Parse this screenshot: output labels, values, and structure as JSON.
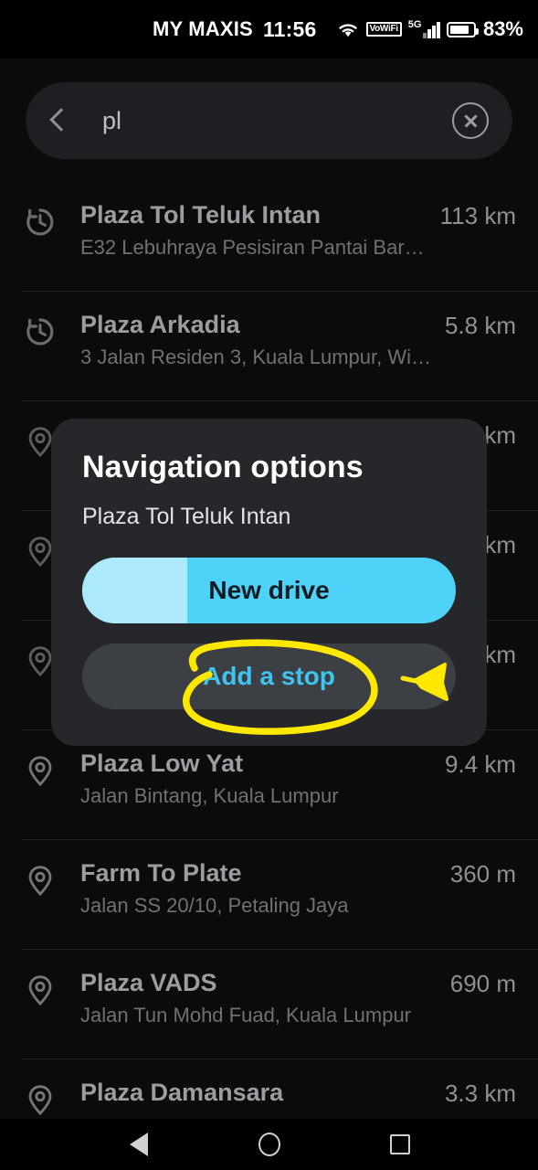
{
  "statusbar": {
    "carrier": "MY MAXIS",
    "time": "11:56",
    "wifi_icon": "wifi-icon",
    "vowifi_label": "VoWiFi",
    "network_label": "5G",
    "battery_icon": "battery-icon",
    "battery_percent": "83%"
  },
  "search": {
    "back_icon": "back-chevron-icon",
    "value": "pl",
    "clear_icon": "clear-circle-icon"
  },
  "results": [
    {
      "icon": "history-clock-icon",
      "title": "Plaza Tol Teluk Intan",
      "subtitle": "E32 Lebuhraya Pesisiran Pantai Bara…",
      "distance": "113 km"
    },
    {
      "icon": "history-clock-icon",
      "title": "Plaza Arkadia",
      "subtitle": "3 Jalan Residen 3, Kuala Lumpur, Wil…",
      "distance": "5.8 km"
    },
    {
      "icon": "map-pin-icon",
      "title": "",
      "subtitle": "",
      "distance": "km"
    },
    {
      "icon": "map-pin-icon",
      "title": "",
      "subtitle": "",
      "distance": "km"
    },
    {
      "icon": "map-pin-icon",
      "title": "",
      "subtitle": "",
      "distance": "km"
    },
    {
      "icon": "map-pin-icon",
      "title": "Plaza Low Yat",
      "subtitle": "Jalan Bintang, Kuala Lumpur",
      "distance": "9.4 km"
    },
    {
      "icon": "map-pin-icon",
      "title": "Farm To Plate",
      "subtitle": "Jalan SS 20/10, Petaling Jaya",
      "distance": "360 m"
    },
    {
      "icon": "map-pin-icon",
      "title": "Plaza VADS",
      "subtitle": "Jalan Tun Mohd Fuad, Kuala Lumpur",
      "distance": "690 m"
    },
    {
      "icon": "map-pin-icon",
      "title": "Plaza Damansara",
      "subtitle": "",
      "distance": "3.3 km"
    }
  ],
  "dialog": {
    "title": "Navigation options",
    "subtitle": "Plaza Tol Teluk Intan",
    "primary_button": "New drive",
    "secondary_button": "Add a stop"
  },
  "annotation": {
    "highlight_icon": "yellow-ellipse-highlight",
    "cursor_icon": "yellow-arrow-cursor",
    "color": "#FFE800"
  },
  "navbar": {
    "back_icon": "nav-back-triangle-icon",
    "home_icon": "nav-home-circle-icon",
    "recents_icon": "nav-recents-square-icon"
  },
  "colors": {
    "accent_cyan": "#4ED2F7",
    "accent_cyan_light": "#ABE9FB",
    "link_cyan": "#3FC4F0",
    "dialog_bg": "#26272B",
    "button_bg": "#3C4045",
    "screen_bg": "#0B0B0C",
    "annotation_yellow": "#FFE800"
  }
}
